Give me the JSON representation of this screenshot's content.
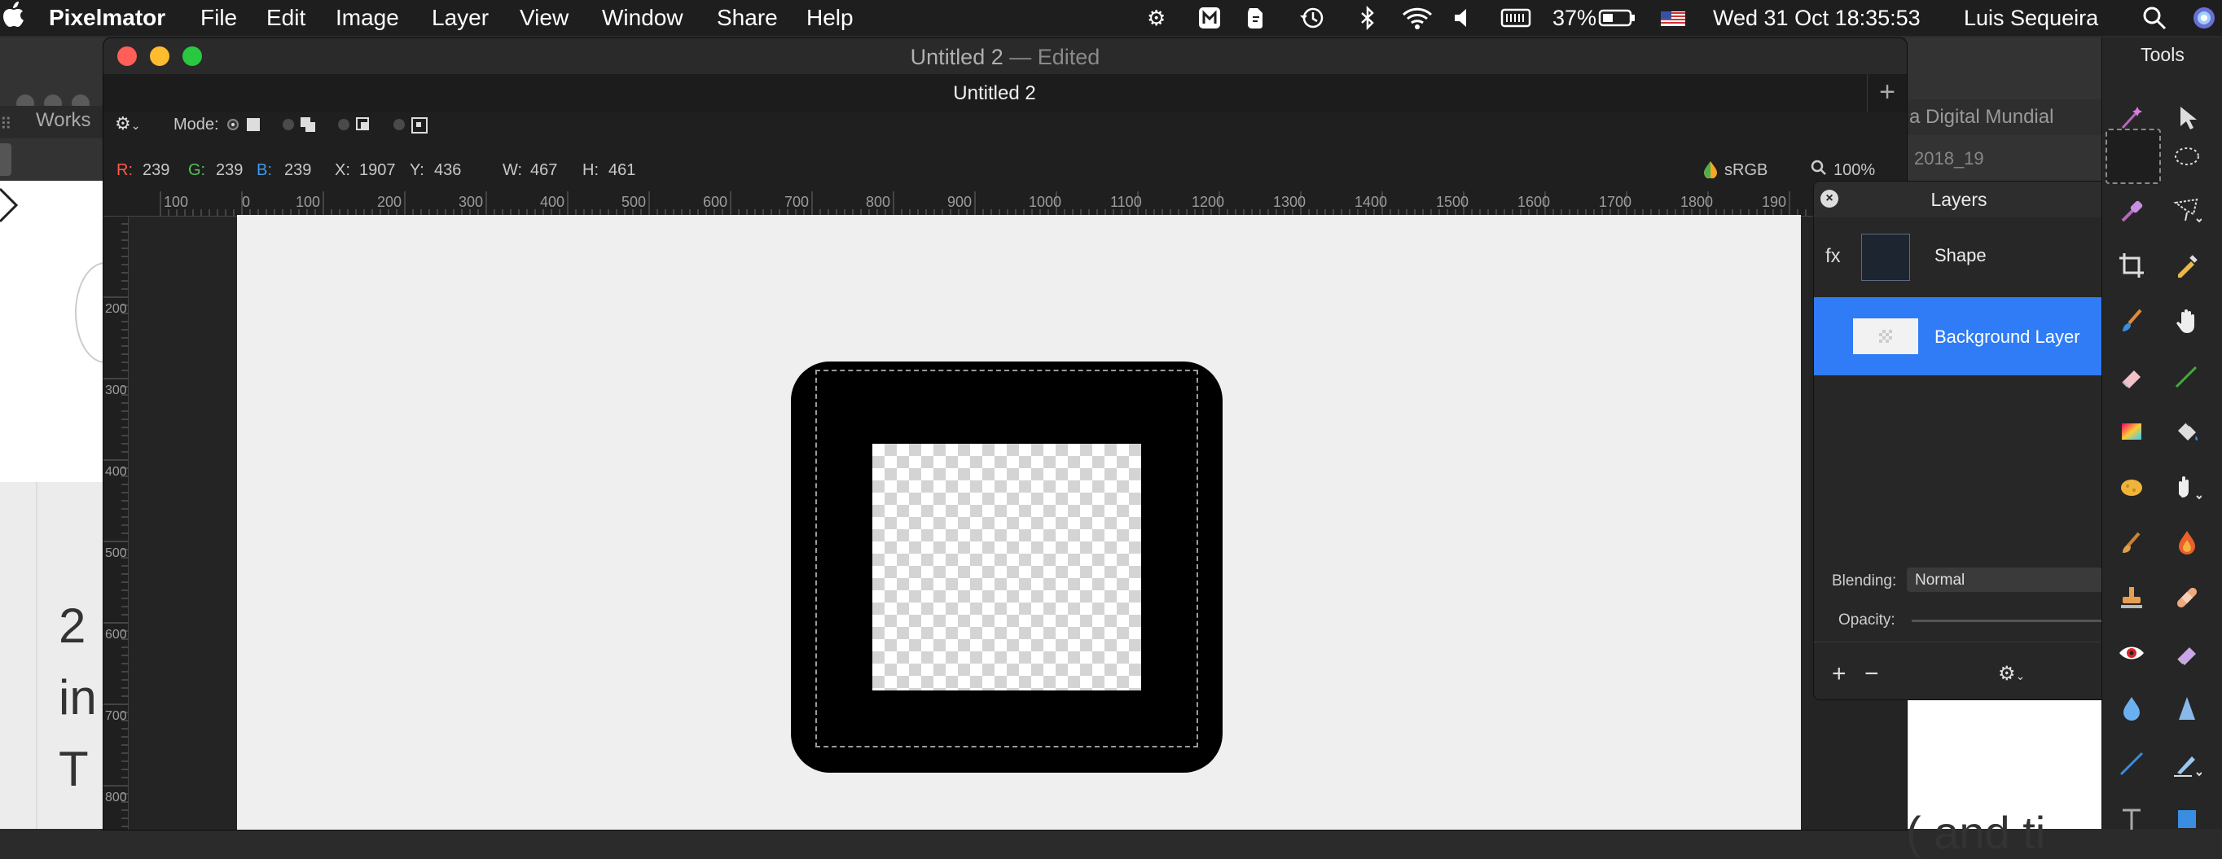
{
  "menubar": {
    "apple": "",
    "app_name": "Pixelmator",
    "menus": [
      "File",
      "Edit",
      "Image",
      "Layer",
      "View",
      "Window",
      "Share",
      "Help"
    ],
    "battery": "37%",
    "datetime": "Wed 31 Oct  18:35:53",
    "user": "Luis Sequeira"
  },
  "background_windows": {
    "left_tab": "Works",
    "left_doc_chars": [
      "2",
      "in",
      "T"
    ],
    "right_tab": "a Digital Mundial",
    "right_sub": "2018_19",
    "right_doc_text": "( and ti"
  },
  "window": {
    "title": "Untitled 2",
    "title_suffix": " — Edited",
    "tab_title": "Untitled 2",
    "new_tab": "+",
    "colors": {
      "close": "#ff5f57",
      "minimize": "#febc2e",
      "zoom": "#28c840"
    }
  },
  "toolbar": {
    "mode_label": "Mode:",
    "r_label": "R:",
    "r_value": "239",
    "g_label": "G:",
    "g_value": "239",
    "b_label": "B:",
    "b_value": "239",
    "x_label": "X:",
    "x_value": "1907",
    "y_label": "Y:",
    "y_value": "436",
    "w_label": "W:",
    "w_value": "467",
    "h_label": "H:",
    "h_value": "461",
    "color_profile": "sRGB",
    "zoom": "100%"
  },
  "ruler": {
    "top_labels": [
      "100",
      "0",
      "100",
      "200",
      "300",
      "400",
      "500",
      "600",
      "700",
      "800",
      "900",
      "1000",
      "1100",
      "1200",
      "1300",
      "1400",
      "1500",
      "1600",
      "1700",
      "1800",
      "190"
    ],
    "left_labels": [
      "200",
      "300",
      "400",
      "500",
      "600",
      "700",
      "800"
    ]
  },
  "layers_panel": {
    "title": "Layers",
    "layers": [
      {
        "name": "Shape",
        "badge": "fx",
        "selected": false
      },
      {
        "name": "Background Layer",
        "badge": "",
        "selected": true
      }
    ],
    "blending_label": "Blending:",
    "blending_value": "Normal",
    "opacity_label": "Opacity:",
    "add": "+",
    "remove": "−",
    "selected_color": "#2f7cf6"
  },
  "tools_panel": {
    "title": "Tools"
  }
}
